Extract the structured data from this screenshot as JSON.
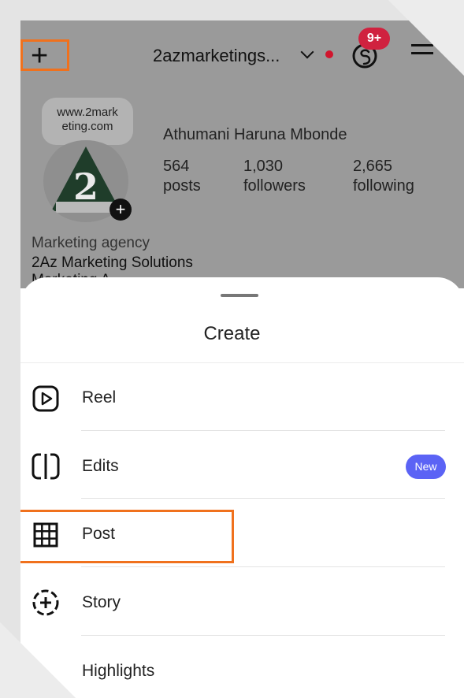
{
  "header": {
    "username": "2azmarketings...",
    "notification_badge": "9+",
    "accent_color": "#f0711d"
  },
  "profile": {
    "website_line1": "www.2mark",
    "website_line2": "eting.com",
    "full_name": "Athumani Haruna Mbonde",
    "stats": [
      {
        "count": "564",
        "label": "posts"
      },
      {
        "count": "1,030",
        "label": "followers"
      },
      {
        "count": "2,665",
        "label": "following"
      }
    ],
    "category": "Marketing agency",
    "bio_line1": "2Az Marketing Solutions",
    "bio_line2": "Marketing A..."
  },
  "sheet": {
    "title": "Create",
    "items": [
      {
        "label": "Reel",
        "icon": "reel-icon"
      },
      {
        "label": "Edits",
        "icon": "edits-icon",
        "badge": "New"
      },
      {
        "label": "Post",
        "icon": "grid-icon"
      },
      {
        "label": "Story",
        "icon": "story-add-icon"
      },
      {
        "label": "Highlights",
        "icon": "highlights-icon"
      }
    ]
  }
}
